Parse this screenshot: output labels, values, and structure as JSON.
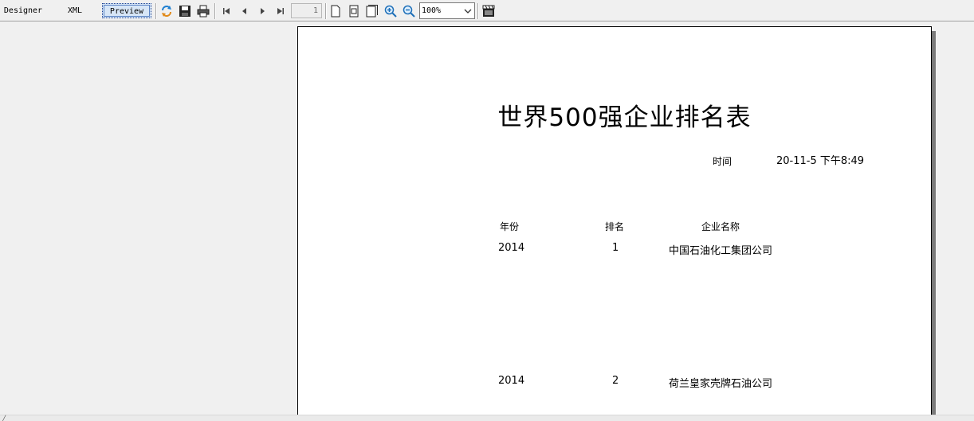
{
  "toolbar": {
    "tabs": [
      "Designer",
      "XML",
      "Preview"
    ],
    "active_tab": "Preview",
    "page_number": "1",
    "zoom": "100%"
  },
  "report": {
    "title": "世界500强企业排名表",
    "time_label": "时间",
    "time_value": "20-11-5 下午8:49",
    "columns": [
      "年份",
      "排名",
      "企业名称"
    ],
    "rows": [
      {
        "year": "2014",
        "rank": "1",
        "company": "中国石油化工集团公司"
      },
      {
        "year": "2014",
        "rank": "2",
        "company": "荷兰皇家壳牌石油公司"
      }
    ]
  },
  "colors": {
    "toolbar_bg": "#f0f0f0",
    "active_tab_bg": "#d7e6f7",
    "page_bg": "#ffffff",
    "page_shadow": "#7a7a7a"
  }
}
